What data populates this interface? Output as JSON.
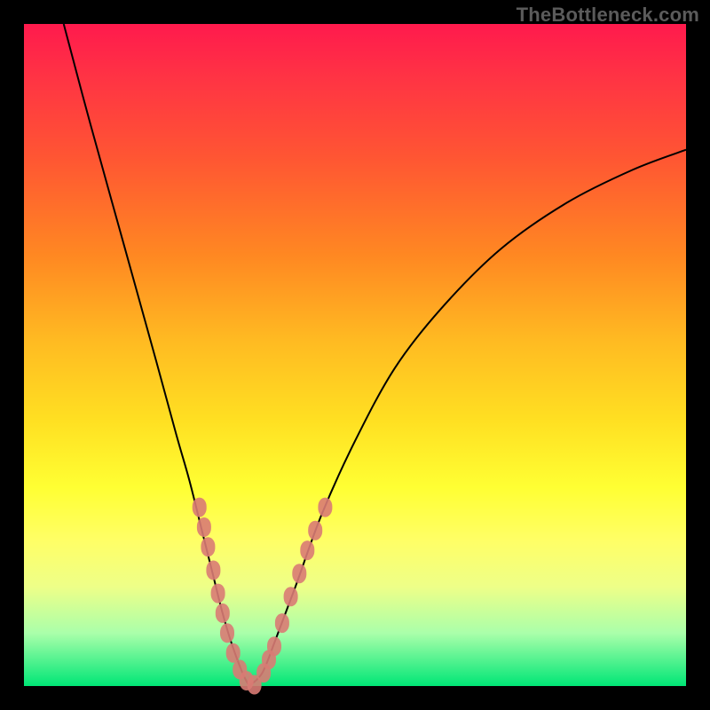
{
  "watermark": "TheBottleneck.com",
  "chart_data": {
    "type": "line",
    "title": "",
    "xlabel": "",
    "ylabel": "",
    "xlim": [
      0,
      100
    ],
    "ylim": [
      0,
      100
    ],
    "legend": false,
    "grid": false,
    "series": [
      {
        "name": "left-branch",
        "x": [
          6,
          10,
          15,
          20,
          23,
          25,
          27,
          28.5,
          30,
          31.5,
          33,
          34
        ],
        "y": [
          100,
          85,
          67,
          49,
          38,
          31,
          23,
          17,
          11,
          6,
          2,
          0
        ]
      },
      {
        "name": "right-branch",
        "x": [
          34,
          36,
          38,
          41,
          45,
          50,
          56,
          63,
          72,
          82,
          92,
          100
        ],
        "y": [
          0,
          2,
          7,
          15,
          26,
          37,
          48,
          57,
          66,
          73,
          78,
          81
        ]
      }
    ],
    "markers": [
      {
        "name": "bead-cluster-left",
        "points": [
          {
            "x": 26.5,
            "y": 27
          },
          {
            "x": 27.2,
            "y": 24
          },
          {
            "x": 27.8,
            "y": 21
          },
          {
            "x": 28.6,
            "y": 17.5
          },
          {
            "x": 29.3,
            "y": 14
          },
          {
            "x": 30.0,
            "y": 11
          },
          {
            "x": 30.7,
            "y": 8
          },
          {
            "x": 31.6,
            "y": 5
          },
          {
            "x": 32.6,
            "y": 2.5
          },
          {
            "x": 33.6,
            "y": 0.8
          },
          {
            "x": 34.8,
            "y": 0.2
          }
        ]
      },
      {
        "name": "bead-cluster-right",
        "points": [
          {
            "x": 36.2,
            "y": 2.0
          },
          {
            "x": 37.0,
            "y": 4.0
          },
          {
            "x": 37.8,
            "y": 6.0
          },
          {
            "x": 39.0,
            "y": 9.5
          },
          {
            "x": 40.3,
            "y": 13.5
          },
          {
            "x": 41.6,
            "y": 17.0
          },
          {
            "x": 42.8,
            "y": 20.5
          },
          {
            "x": 44.0,
            "y": 23.5
          },
          {
            "x": 45.5,
            "y": 27.0
          }
        ]
      }
    ],
    "background_gradient": {
      "type": "vertical",
      "stops": [
        {
          "pos": 0.0,
          "color": "#ff1a4d"
        },
        {
          "pos": 0.35,
          "color": "#ff8822"
        },
        {
          "pos": 0.7,
          "color": "#ffff33"
        },
        {
          "pos": 1.0,
          "color": "#00e676"
        }
      ]
    }
  }
}
